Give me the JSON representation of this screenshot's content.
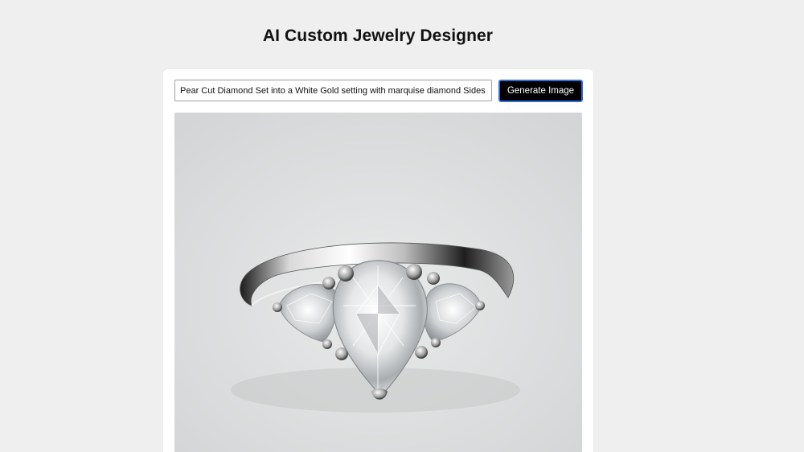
{
  "header": {
    "title": "AI Custom Jewelry Designer"
  },
  "form": {
    "prompt_value": "Pear Cut Diamond Set into a White Gold setting with marquise diamond Sides",
    "generate_label": "Generate Image"
  },
  "result": {
    "image_subject": "diamond-ring"
  },
  "colors": {
    "page_background": "#efefef",
    "card_background": "#ffffff",
    "button_background": "#000000",
    "button_focus_ring": "#2f6fdc"
  }
}
